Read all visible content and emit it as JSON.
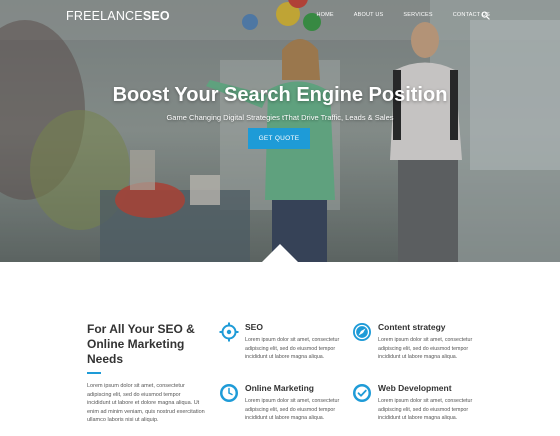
{
  "brand": {
    "logo_light": "FREELANCE",
    "logo_bold": "SEO"
  },
  "nav": {
    "items": [
      {
        "label": "HOME"
      },
      {
        "label": "ABOUT US"
      },
      {
        "label": "SERVICES"
      },
      {
        "label": "CONTACT US"
      }
    ],
    "search_icon": "search-icon"
  },
  "hero": {
    "title": "Boost Your Search Engine Position",
    "subtitle": "Game Changing Digital Strategies tThat Drive Traffic, Leads & Sales",
    "cta_label": "GET QUOTE"
  },
  "intro": {
    "title": "For All Your SEO & Online Marketing Needs",
    "text": "Lorem ipsum dolor sit amet, consectetur adipiscing elit, sed do eiusmod tempor incididunt ut labore et dolore magna aliqua. Ut enim ad minim veniam, quis nostrud exercitation ullamco laboris nisi ut aliquip."
  },
  "features": [
    {
      "title": "SEO",
      "icon": "crosshair-icon",
      "text": "Lorem ipsum dolor sit amet, consectetur adipiscing elit, sed do eiusmod tempor incididunt ut labore magna aliqua."
    },
    {
      "title": "Content strategy",
      "icon": "compass-icon",
      "text": "Lorem ipsum dolor sit amet, consectetur adipiscing elit, sed do eiusmod tempor incididunt ut labore magna aliqua."
    },
    {
      "title": "Online Marketing",
      "icon": "clock-icon",
      "text": "Lorem ipsum dolor sit amet, consectetur adipiscing elit, sed do eiusmod tempor incididunt ut labore magna aliqua."
    },
    {
      "title": "Web Development",
      "icon": "check-circle-icon",
      "text": "Lorem ipsum dolor sit amet, consectetur adipiscing elit, sed do eiusmod tempor incididunt ut labore magna aliqua."
    }
  ],
  "colors": {
    "accent": "#1e9bd7",
    "heading": "#333333",
    "body": "#555555"
  }
}
